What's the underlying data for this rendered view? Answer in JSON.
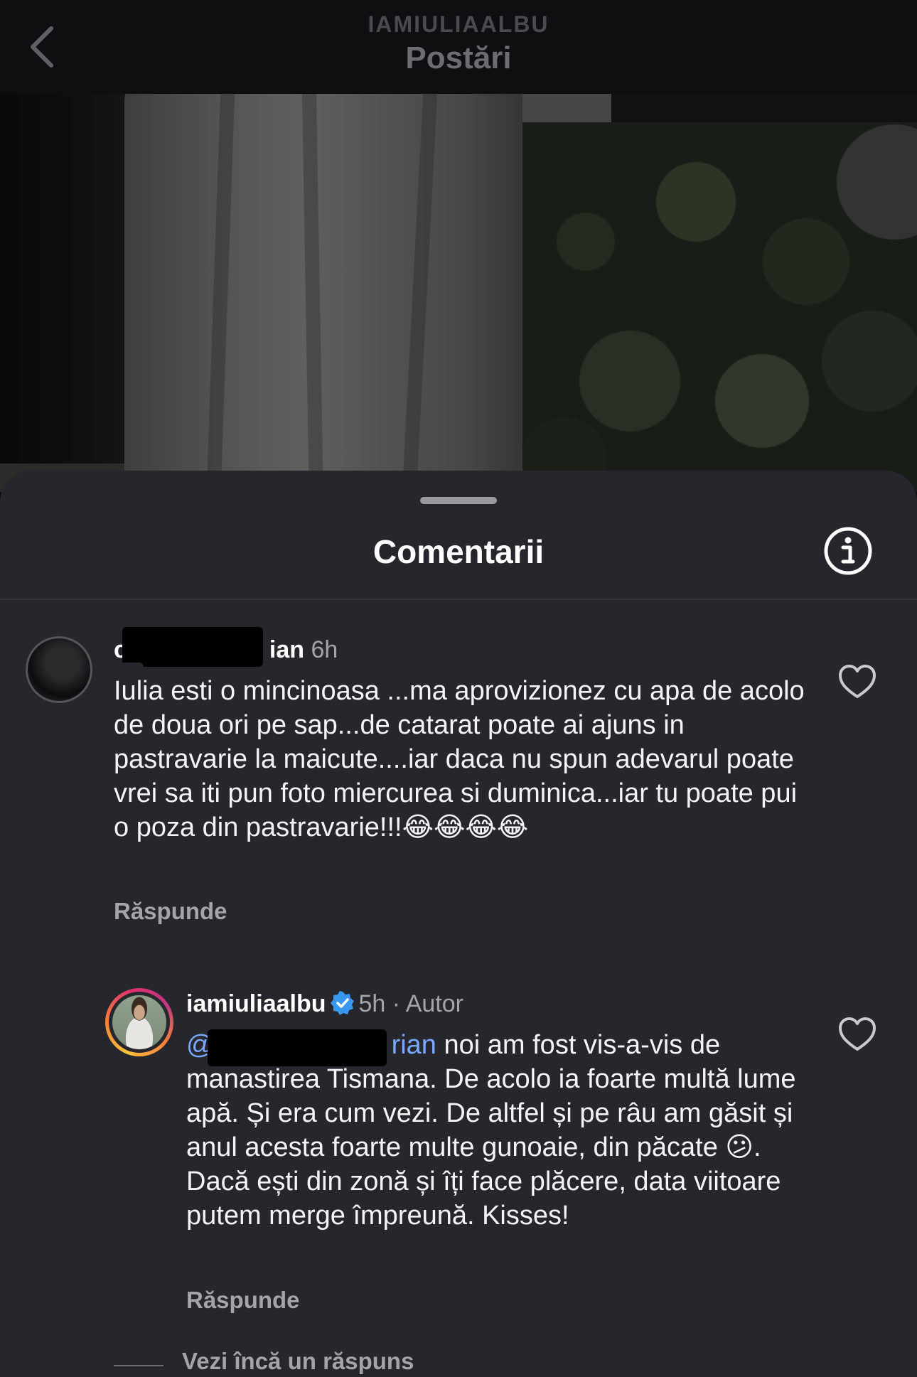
{
  "header": {
    "account": "IAMIULIAALBU",
    "title": "Postări",
    "back_icon": "chevron-left-icon"
  },
  "sheet": {
    "title": "Comentarii",
    "info_icon": "info-icon"
  },
  "comments": [
    {
      "username_visible_start": "c",
      "username_visible_end": "ian",
      "time": "6h",
      "text": "Iulia esti o mincinoasa ...ma aprovizionez cu apa de acolo de doua ori pe sap...de catarat poate ai ajuns in pastravarie la maicute....iar daca nu spun adevarul poate vrei sa iti pun foto miercurea si duminica...iar tu poate pui o poza din pastravarie!!!😂😂😂😂",
      "reply_label": "Răspunde",
      "like_icon": "heart-outline-icon"
    },
    {
      "username": "iamiuliaalbu",
      "verified_icon": "verified-badge-icon",
      "time": "5h",
      "separator": "·",
      "role": "Autor",
      "mention_start": "@",
      "mention_end": "rian",
      "text": " noi am fost vis-a-vis de manastirea Tismana. De acolo ia foarte multă lume apă. Și era cum vezi. De altfel și pe râu am găsit și anul acesta foarte multe gunoaie, din păcate 😕. Dacă ești din zonă și îți face plăcere, data viitoare putem merge împreună. Kisses!",
      "reply_label": "Răspunde",
      "like_icon": "heart-outline-icon"
    }
  ],
  "more_replies": "Vezi încă un răspuns",
  "colors": {
    "sheet_bg": "#25272c",
    "secondary_text": "#a3a5ab",
    "verified_blue": "#3897f0"
  }
}
